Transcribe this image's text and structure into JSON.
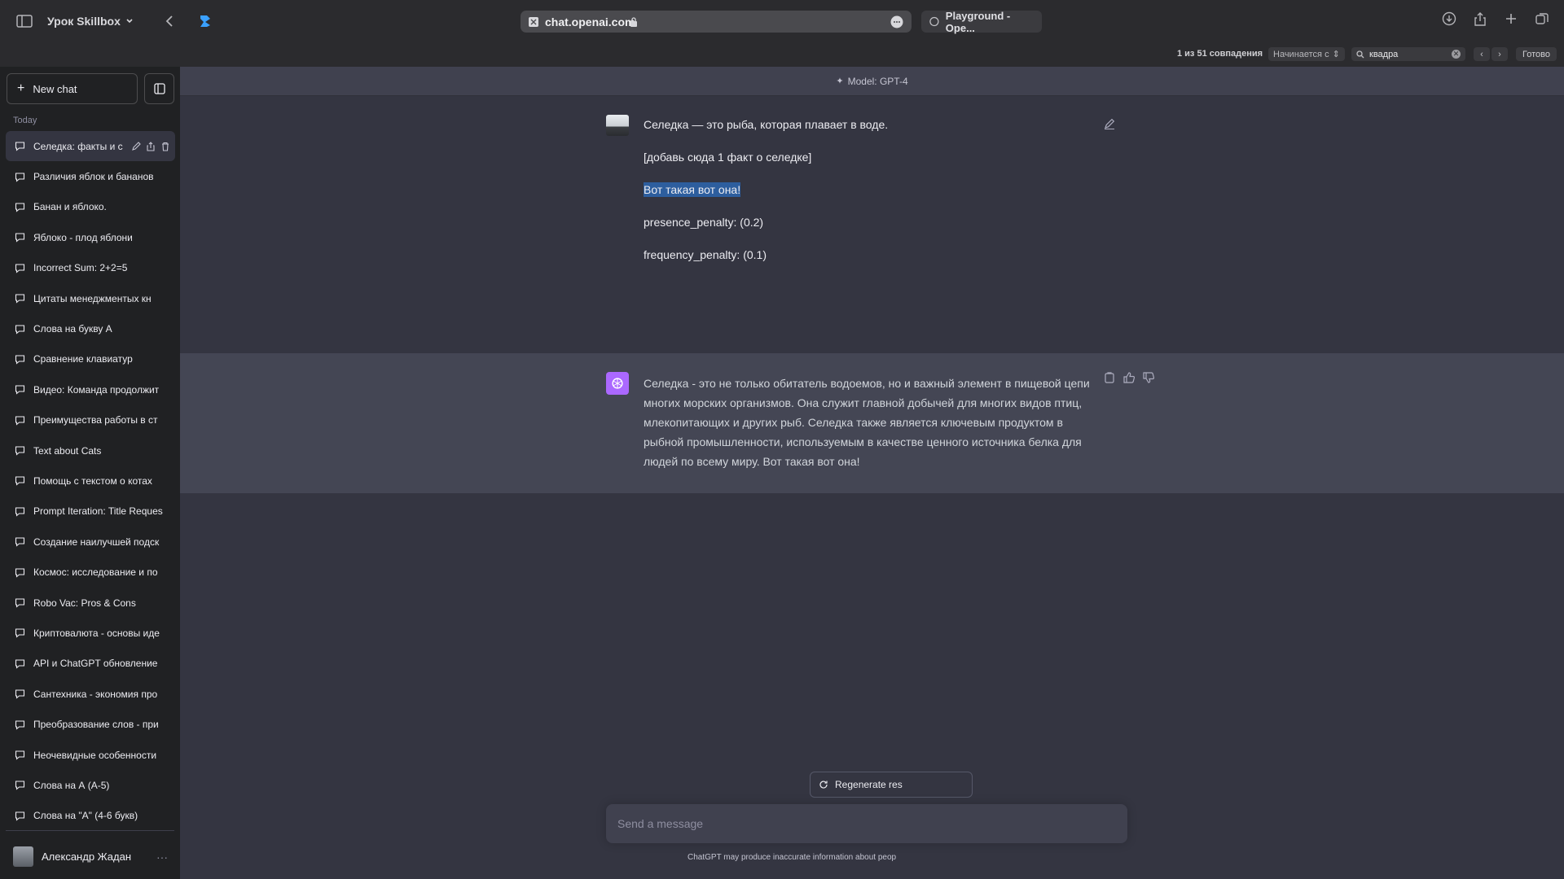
{
  "browser": {
    "profile_name": "Урок Skillbox",
    "url": "chat.openai.com",
    "second_tab": "Playground - Ope..."
  },
  "find_bar": {
    "match_count": "1 из 51 совпадения",
    "mode": "Начинается с",
    "query": "квадра",
    "done_label": "Готово"
  },
  "sidebar": {
    "new_chat_label": "New chat",
    "section_label": "Today",
    "chats": [
      "Селедка: факты и с",
      "Различия яблок и бананов",
      "Банан и яблоко.",
      "Яблоко - плод яблони",
      "Incorrect Sum: 2+2=5",
      "Цитаты менеджментых кн",
      "Слова на букву А",
      "Сравнение клавиатур",
      "Видео: Команда продолжит",
      "Преимущества работы в ст",
      "Text about Cats",
      "Помощь с текстом о котах",
      "Prompt Iteration: Title Reques",
      "Создание наилучшей подск",
      "Космос: исследование и по",
      "Robo Vac: Pros & Cons",
      "Криптовалюта - основы иде",
      "API и ChatGPT обновление",
      "Сантехника - экономия про",
      "Преобразование слов - при",
      "Неочевидные особенности",
      "Слова на А (А-5)",
      "Слова на \"А\" (4-6 букв)"
    ],
    "user_name": "Александр Жадан",
    "user_menu": "···"
  },
  "chat": {
    "model_label": "Model: GPT-4",
    "user_message": {
      "line1": "Селедка — это рыба, которая плавает в воде.",
      "line2": "[добавь сюда 1 факт о селедке]",
      "line3": "Вот такая вот она!",
      "line4": "presence_penalty: (0.2)",
      "line5": "frequency_penalty: (0.1)"
    },
    "assistant_message": "Селедка - это не только обитатель водоемов, но и важный элемент в пищевой цепи многих морских организмов. Она служит главной добычей для многих видов птиц, млекопитающих и других рыб. Селедка также является ключевым продуктом в рыбной промышленности, используемым в качестве ценного источника белка для людей по всему миру. Вот такая вот она!",
    "regenerate_label": "Regenerate res",
    "input_placeholder": "Send a message",
    "disclaimer": "ChatGPT may produce inaccurate information about peop"
  },
  "colors": {
    "sidebar_bg": "#202123",
    "main_bg": "#343541",
    "assistant_bg": "#444654",
    "highlight": "#2d5e9e",
    "gpt4_accent": "#ab68ff"
  }
}
